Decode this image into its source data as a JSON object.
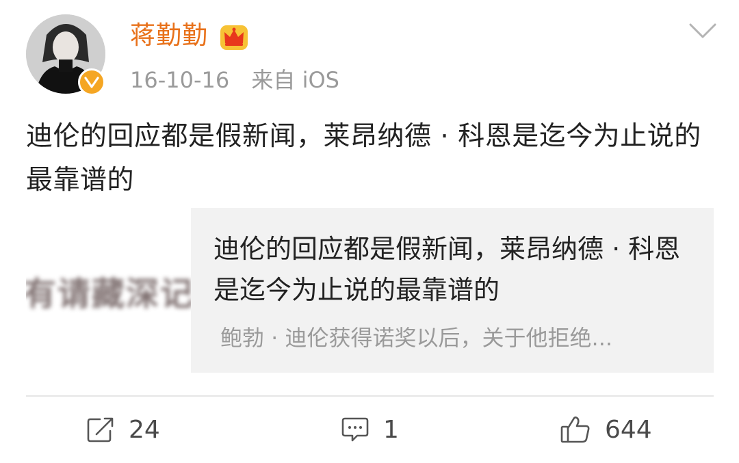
{
  "post": {
    "username": "蒋勤勤",
    "timestamp": "16-10-16",
    "source": "来自 iOS",
    "text": "迪伦的回应都是假新闻，莱昂纳德 · 科恩是迄今为止说的最靠谱的",
    "avatar_icon": "user-avatar",
    "verified_icon": "verified-badge",
    "member_icon": "crown-icon"
  },
  "card": {
    "thumbnail_text": "有请藏深记",
    "title": "迪伦的回应都是假新闻，莱昂纳德 · 科恩是迄今为止说的最靠谱的",
    "description": "鲍勃 · 迪伦获得诺奖以后，关于他拒绝..."
  },
  "actions": {
    "share_count": "24",
    "comment_count": "1",
    "like_count": "644"
  },
  "colors": {
    "username": "#e8711a",
    "meta": "#9a9a9a",
    "card_bg": "#f2f2f2",
    "verified": "#f5a623"
  }
}
